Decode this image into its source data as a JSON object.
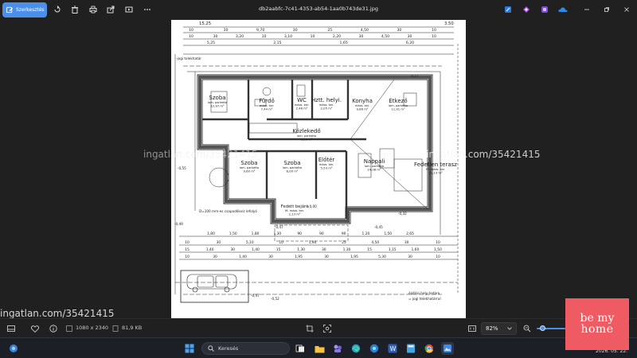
{
  "toolbar": {
    "edit_label": "Szerkesztés",
    "file_title": "db2aabfc-7c41-4353-ab54-1aa0b743de31.jpg"
  },
  "icons": {
    "edit": "pencil-image-icon",
    "rotate": "rotate-icon",
    "delete": "trash-icon",
    "print": "printer-icon",
    "share": "share-icon",
    "slideshow": "slideshow-icon",
    "more": "more-icon"
  },
  "floorplan": {
    "top_dims_row1": [
      "10",
      "30",
      "9,70",
      "30",
      "25",
      "4,50",
      "30",
      "10"
    ],
    "top_dims_row2": [
      "10",
      "30",
      "3,20",
      "10",
      "3,10",
      "10",
      "2,20",
      "30",
      "4,50",
      "30",
      "10"
    ],
    "top_dims_row3": [
      "5,25",
      "2,15",
      "1,65",
      "6,20"
    ],
    "top_dim_total": "15,25",
    "top_dim_right": "3,50",
    "rooms": [
      {
        "name": "Szoba",
        "floor": "lam. parketta",
        "area": "12,97 m²"
      },
      {
        "name": "Fürdő",
        "floor": "mázs. ker.",
        "area": "7,44 m²"
      },
      {
        "name": "WC",
        "floor": "mázs. ker.",
        "area": "2,46 m²"
      },
      {
        "name": "Hztt. helyi.",
        "floor": "mázs. ker.",
        "area": "2,05 m²"
      },
      {
        "name": "Konyha",
        "floor": "mázs. ker.",
        "area": "9,86 m²"
      },
      {
        "name": "Étkező",
        "floor": "lam. parketta",
        "area": "11,91 m²"
      },
      {
        "name": "Közlekedő",
        "floor": "lam. parketta",
        "area": "9,13 m²"
      },
      {
        "name": "Szoba",
        "floor": "lam. parketta",
        "area": "9,60 m²"
      },
      {
        "name": "Szoba",
        "floor": "lam. parketta",
        "area": "8,00 m²"
      },
      {
        "name": "Előtér",
        "floor": "mázs. ker.",
        "area": "5,53 m²"
      },
      {
        "name": "Nappali",
        "floor": "lam. parketta",
        "area": "24,08 m²"
      },
      {
        "name": "Fedett bejáró",
        "floor": "fé. mázs. ker.",
        "area": "2,13 m²"
      },
      {
        "name": "Fedetlen terasz",
        "floor": "fé. mázs. ker.",
        "area": "20,13 m²"
      }
    ],
    "levels": [
      "-0,55",
      "±0,00",
      "-0,32",
      "-0,47",
      "-0,49",
      "-0,45",
      "-0,52",
      "-0,17",
      "-0,47"
    ],
    "notes": [
      "-jogi telekhatár",
      "építési hely határa",
      "= jogi telekhatárral",
      "D=100 mm-es csapadékvíz lefolyó"
    ],
    "bottom_dims_row1": [
      "1,80",
      "1,50",
      "1,80",
      "1,30",
      "90",
      "90",
      "90",
      "1,20",
      "1,50",
      "2,65"
    ],
    "bottom_dims_row2": [
      "10",
      "30",
      "5,10",
      "10",
      "1,90",
      "25",
      "4,50",
      "30",
      "10"
    ],
    "bottom_dims_row3": [
      "15",
      "1,40",
      "30",
      "1,40",
      "15",
      "1,30",
      "30",
      "1,30",
      "15",
      "1,15",
      "1,60",
      "1,50"
    ],
    "bottom_dims_row4": [
      "10",
      "30",
      "1,40",
      "30",
      "1,95",
      "30",
      "1,95",
      "5,30",
      "30",
      "10"
    ]
  },
  "watermarks": [
    "ingatlan.com/35421415",
    "ingatlan.com/35421415",
    "ingatlan.com/35421415"
  ],
  "status": {
    "dimensions": "1080 x 2340",
    "file_size": "81,9 KB",
    "zoom": "82%",
    "zoom_level": 0.82
  },
  "taskbar": {
    "search_placeholder": "Keresés",
    "date": "2026. 05. 22."
  },
  "brand": {
    "line1": "be my",
    "line2": "home",
    "color": "#ee5b63"
  },
  "colors": {
    "accent": "#4c8fe8",
    "background": "#202020"
  }
}
